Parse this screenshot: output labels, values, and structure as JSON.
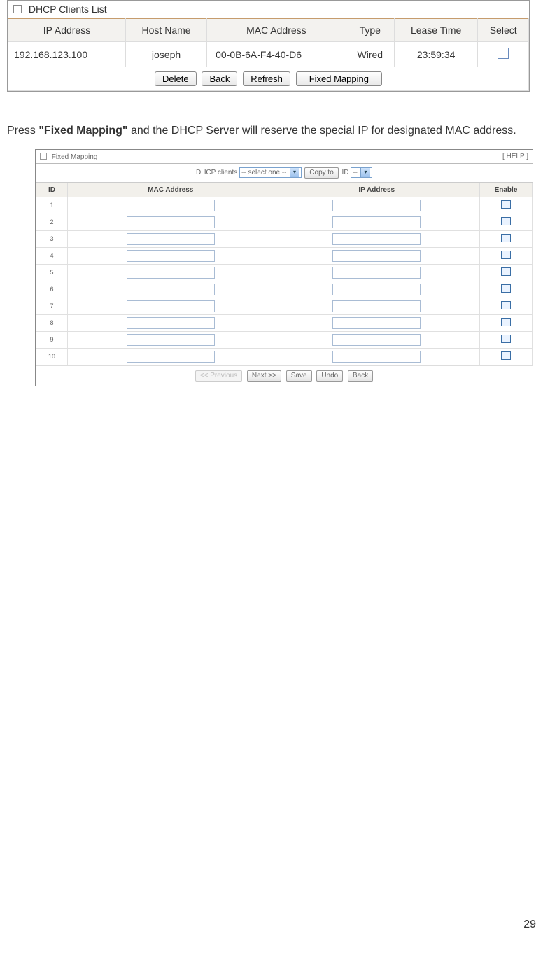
{
  "dhcp_clients": {
    "title": "DHCP Clients List",
    "headers": [
      "IP Address",
      "Host Name",
      "MAC Address",
      "Type",
      "Lease Time",
      "Select"
    ],
    "rows": [
      {
        "ip": "192.168.123.100",
        "host": "joseph",
        "mac": "00-0B-6A-F4-40-D6",
        "type": "Wired",
        "lease": "23:59:34"
      }
    ],
    "buttons": {
      "delete": "Delete",
      "back": "Back",
      "refresh": "Refresh",
      "fixed_mapping": "Fixed Mapping"
    }
  },
  "body_text": {
    "prefix": "Press ",
    "bold": "\"Fixed Mapping\"",
    "suffix": " and the DHCP Server will reserve the special IP for designated MAC address."
  },
  "fixed_mapping": {
    "title": "Fixed Mapping",
    "help": "[ HELP ]",
    "controls": {
      "label_clients": "DHCP clients",
      "select_one": "-- select one --",
      "copy_to": "Copy to",
      "id_label": "ID",
      "id_value": "--"
    },
    "headers": {
      "id": "ID",
      "mac": "MAC Address",
      "ip": "IP Address",
      "enable": "Enable"
    },
    "row_ids": [
      "1",
      "2",
      "3",
      "4",
      "5",
      "6",
      "7",
      "8",
      "9",
      "10"
    ],
    "buttons": {
      "prev": "<< Previous",
      "next": "Next >>",
      "save": "Save",
      "undo": "Undo",
      "back": "Back"
    }
  },
  "page_number": "29"
}
